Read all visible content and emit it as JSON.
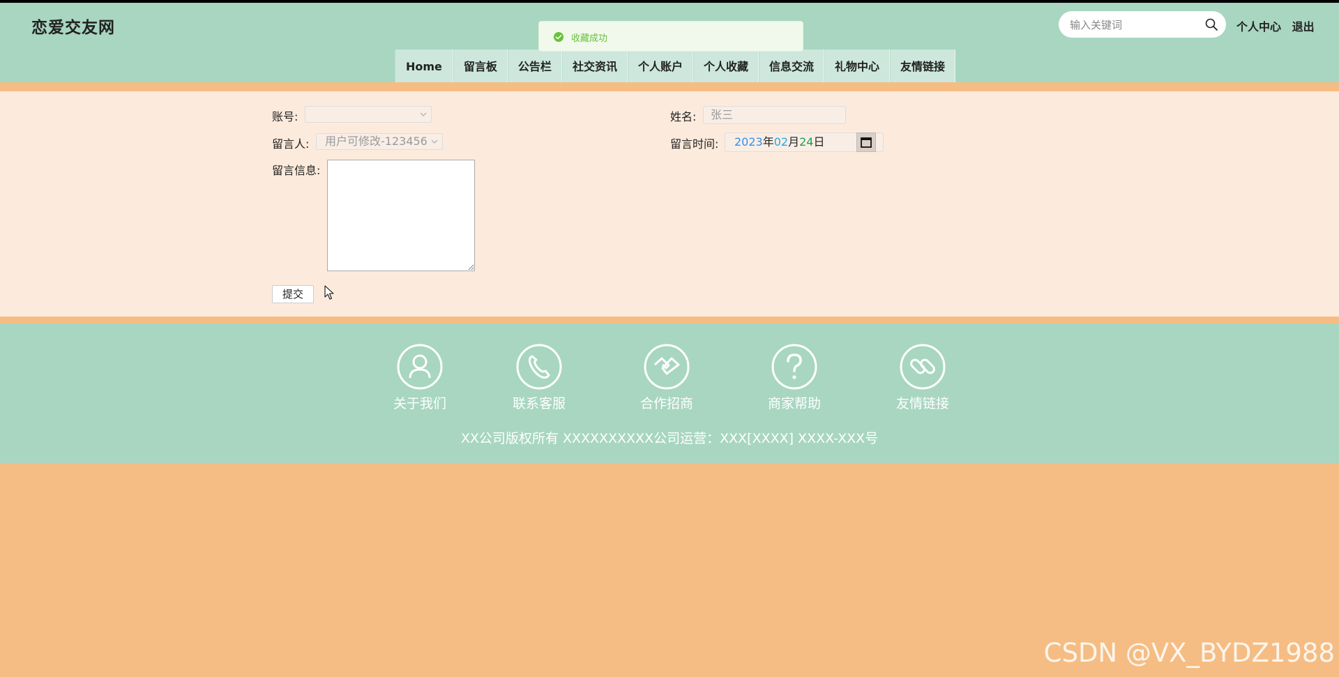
{
  "header": {
    "logo": "恋爱交友网",
    "search_placeholder": "输入关键词",
    "user_center": "个人中心",
    "logout": "退出"
  },
  "toast": {
    "message": "收藏成功"
  },
  "nav": {
    "items": [
      "Home",
      "留言板",
      "公告栏",
      "社交资讯",
      "个人账户",
      "个人收藏",
      "信息交流",
      "礼物中心",
      "友情链接"
    ]
  },
  "form": {
    "account_label": "账号:",
    "account_value": "",
    "name_label": "姓名:",
    "name_value": "张三",
    "author_label": "留言人:",
    "author_value": "用户可修改-123456",
    "time_label": "留言时间:",
    "date": {
      "year": "2023",
      "year_unit": "年",
      "month": "02",
      "month_unit": "月",
      "day": "24",
      "day_unit": "日"
    },
    "message_label": "留言信息:",
    "message_value": "",
    "submit_label": "提交"
  },
  "footer": {
    "items": [
      {
        "label": "关于我们",
        "icon": "user-icon"
      },
      {
        "label": "联系客服",
        "icon": "phone-icon"
      },
      {
        "label": "合作招商",
        "icon": "handshake-icon"
      },
      {
        "label": "商家帮助",
        "icon": "question-icon"
      },
      {
        "label": "友情链接",
        "icon": "link-icon"
      }
    ],
    "copyright": "XX公司版权所有 XXXXXXXXXX公司运营：XXX[XXXX] XXXX-XXX号"
  },
  "watermark": "CSDN @VX_BYDZ1988",
  "colors": {
    "header_bg": "#a8d6c1",
    "accent_orange": "#f5bd83",
    "content_bg": "#fcebdc",
    "toast_green": "#67c23a"
  }
}
